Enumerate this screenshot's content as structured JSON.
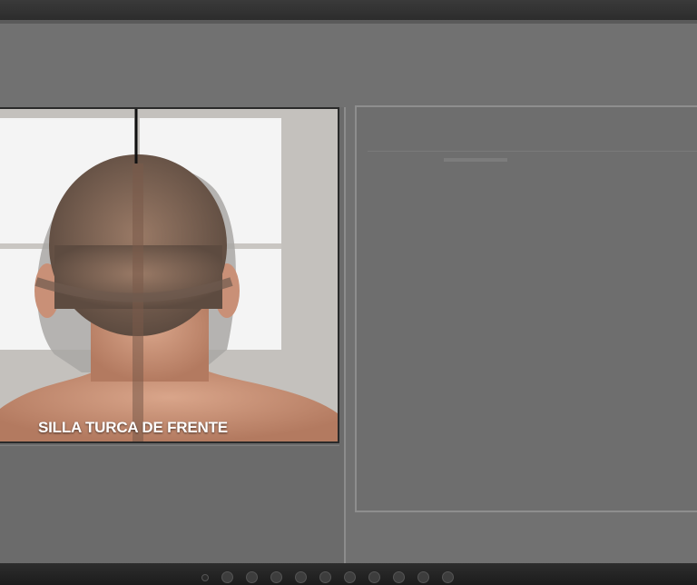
{
  "slide": {
    "caption": "SILLA TURCA DE FRENTE"
  },
  "monitor": {
    "buttons": [
      {
        "icon": "power-dot-icon"
      },
      {
        "icon": "menu-button-icon"
      },
      {
        "icon": "minus-button-icon"
      },
      {
        "icon": "plus-button-icon"
      },
      {
        "icon": "source-button-icon"
      },
      {
        "icon": "auto-button-icon"
      },
      {
        "icon": "left-button-icon"
      },
      {
        "icon": "right-button-icon"
      },
      {
        "icon": "up-button-icon"
      },
      {
        "icon": "play-button-icon"
      },
      {
        "icon": "exit-button-icon"
      }
    ]
  },
  "colors": {
    "background": "#717171",
    "bezel": "#2a2a2a",
    "caption_text": "#ffffff"
  }
}
